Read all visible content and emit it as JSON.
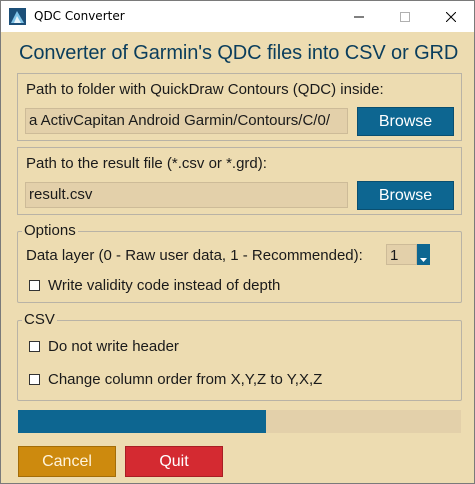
{
  "window": {
    "title": "QDC Converter",
    "controls": [
      "minimize-icon",
      "maximize-icon",
      "close-icon"
    ]
  },
  "heading": "Converter of Garmin's QDC files into CSV or GRD",
  "input_section": {
    "label": "Path to folder with QuickDraw Contours (QDC) inside:",
    "value": "a ActivCapitan Android Garmin/Contours/C/0/",
    "browse_label": "Browse"
  },
  "output_section": {
    "label": "Path to the result file (*.csv or *.grd):",
    "value": "result.csv",
    "browse_label": "Browse"
  },
  "options": {
    "title": "Options",
    "data_layer_label": "Data layer (0 - Raw user data, 1 - Recommended):",
    "data_layer_value": "1",
    "validity_label": "Write validity code instead of depth",
    "validity_checked": false
  },
  "csv": {
    "title": "CSV",
    "no_header_label": "Do not write header",
    "no_header_checked": false,
    "column_order_label": "Change column order from X,Y,Z to Y,X,Z",
    "column_order_checked": false
  },
  "progress": {
    "fraction": 0.56
  },
  "buttons": {
    "cancel_label": "Cancel",
    "quit_label": "Quit"
  },
  "colors": {
    "background": "#eddcb1",
    "field": "#e3d0aa",
    "accent_blue": "#0d6691",
    "heading": "#0a3d5c",
    "cancel": "#cd8a0e",
    "quit": "#d42a31"
  }
}
